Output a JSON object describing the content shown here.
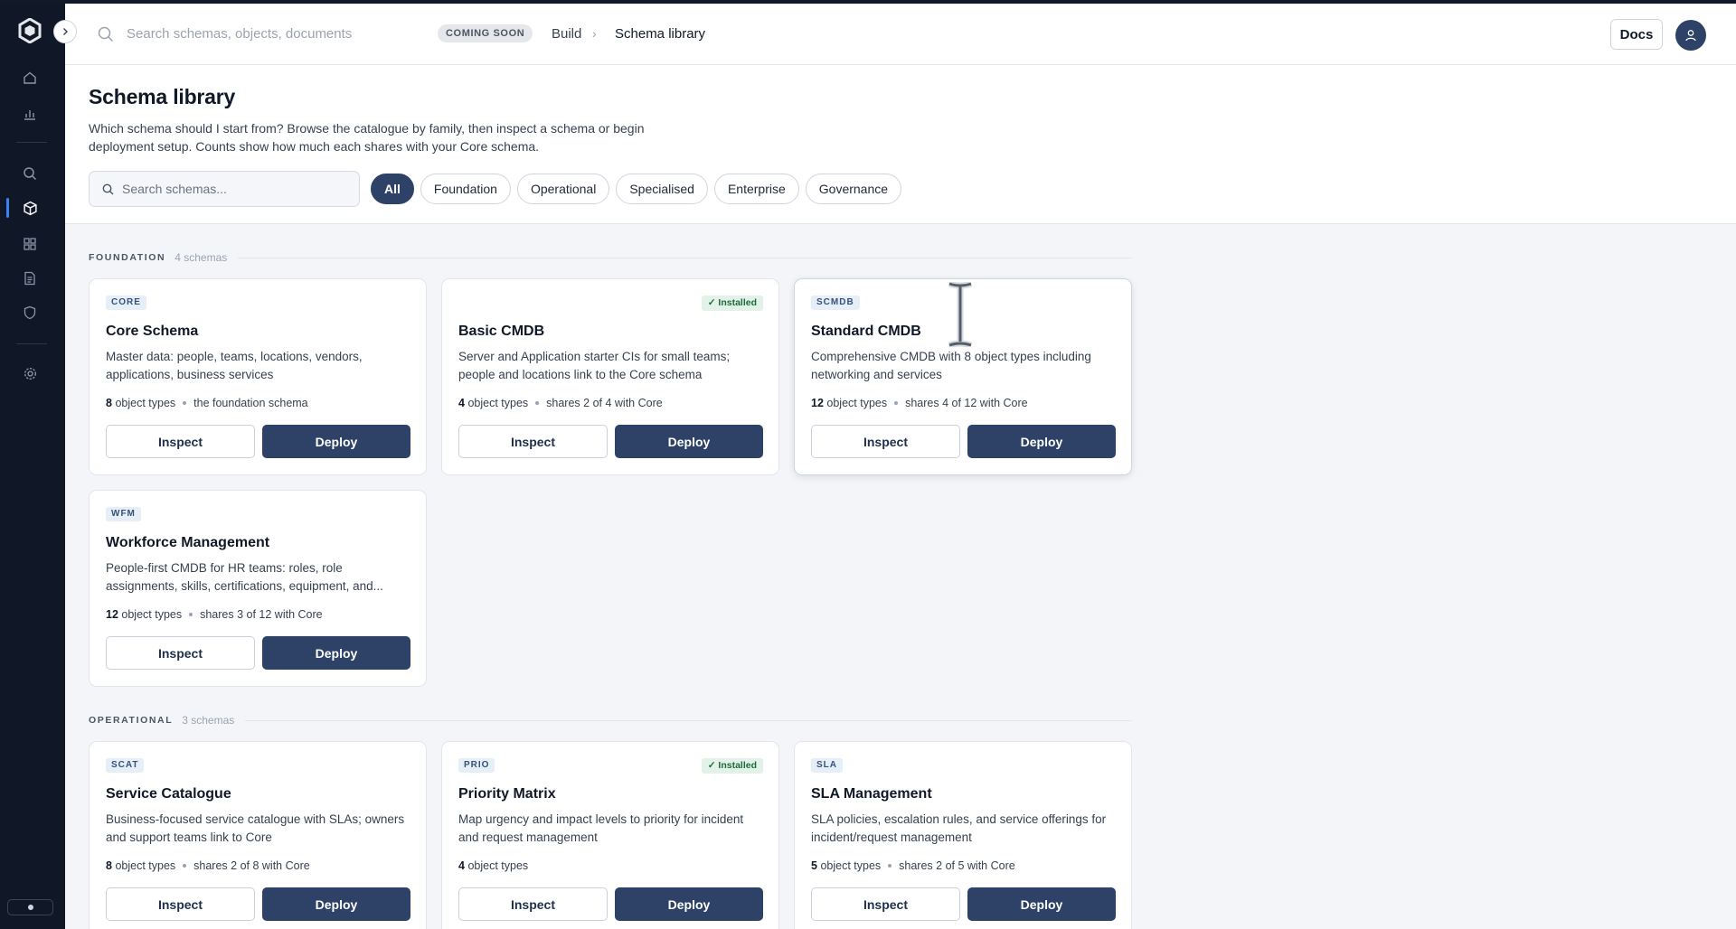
{
  "header": {
    "search_placeholder": "Search schemas, objects, documents",
    "coming_soon": "COMING SOON",
    "breadcrumb_parent": "Build",
    "breadcrumb_current": "Schema library",
    "docs_label": "Docs"
  },
  "sidebar": {
    "icons": [
      "home-icon",
      "chart-icon",
      "search-icon",
      "cube-icon",
      "grid-icon",
      "document-icon",
      "shield-icon",
      "gear-icon"
    ],
    "active": "cube-icon"
  },
  "page": {
    "title": "Schema library",
    "description": "Which schema should I start from? Browse the catalogue by family, then inspect a schema or begin deployment setup. Counts show how much each shares with your Core schema.",
    "search_placeholder": "Search schemas...",
    "filters": [
      "All",
      "Foundation",
      "Operational",
      "Specialised",
      "Enterprise",
      "Governance"
    ],
    "active_filter": "All"
  },
  "buttons": {
    "inspect": "Inspect",
    "deploy": "Deploy"
  },
  "sections": [
    {
      "name": "FOUNDATION",
      "count": "4 schemas",
      "cards": [
        {
          "code": "CORE",
          "title": "Core Schema",
          "desc": "Master data: people, teams, locations, vendors, applications, business services",
          "types_num": "8",
          "types_label": "object types",
          "meta": "the foundation schema",
          "installed": ""
        },
        {
          "code": "",
          "title": "Basic CMDB",
          "desc": "Server and Application starter CIs for small teams; people and locations link to the Core schema",
          "types_num": "4",
          "types_label": "object types",
          "meta": "shares 2 of 4 with Core",
          "installed": "✓ Installed"
        },
        {
          "code": "SCMDB",
          "title": "Standard CMDB",
          "desc": "Comprehensive CMDB with 8 object types including networking and services",
          "types_num": "12",
          "types_label": "object types",
          "meta": "shares 4 of 12 with Core",
          "installed": ""
        },
        {
          "code": "WFM",
          "title": "Workforce Management",
          "desc": "People-first CMDB for HR teams: roles, role assignments, skills, certifications, equipment, and...",
          "types_num": "12",
          "types_label": "object types",
          "meta": "shares 3 of 12 with Core",
          "installed": ""
        }
      ]
    },
    {
      "name": "OPERATIONAL",
      "count": "3 schemas",
      "cards": [
        {
          "code": "SCAT",
          "title": "Service Catalogue",
          "desc": "Business-focused service catalogue with SLAs; owners and support teams link to Core",
          "types_num": "8",
          "types_label": "object types",
          "meta": "shares 2 of 8 with Core",
          "installed": ""
        },
        {
          "code": "PRIO",
          "title": "Priority Matrix",
          "desc": "Map urgency and impact levels to priority for incident and request management",
          "types_num": "4",
          "types_label": "object types",
          "meta": "",
          "installed": "✓ Installed"
        },
        {
          "code": "SLA",
          "title": "SLA Management",
          "desc": "SLA policies, escalation rules, and service offerings for incident/request management",
          "types_num": "5",
          "types_label": "object types",
          "meta": "shares 2 of 5 with Core",
          "installed": ""
        }
      ]
    }
  ]
}
